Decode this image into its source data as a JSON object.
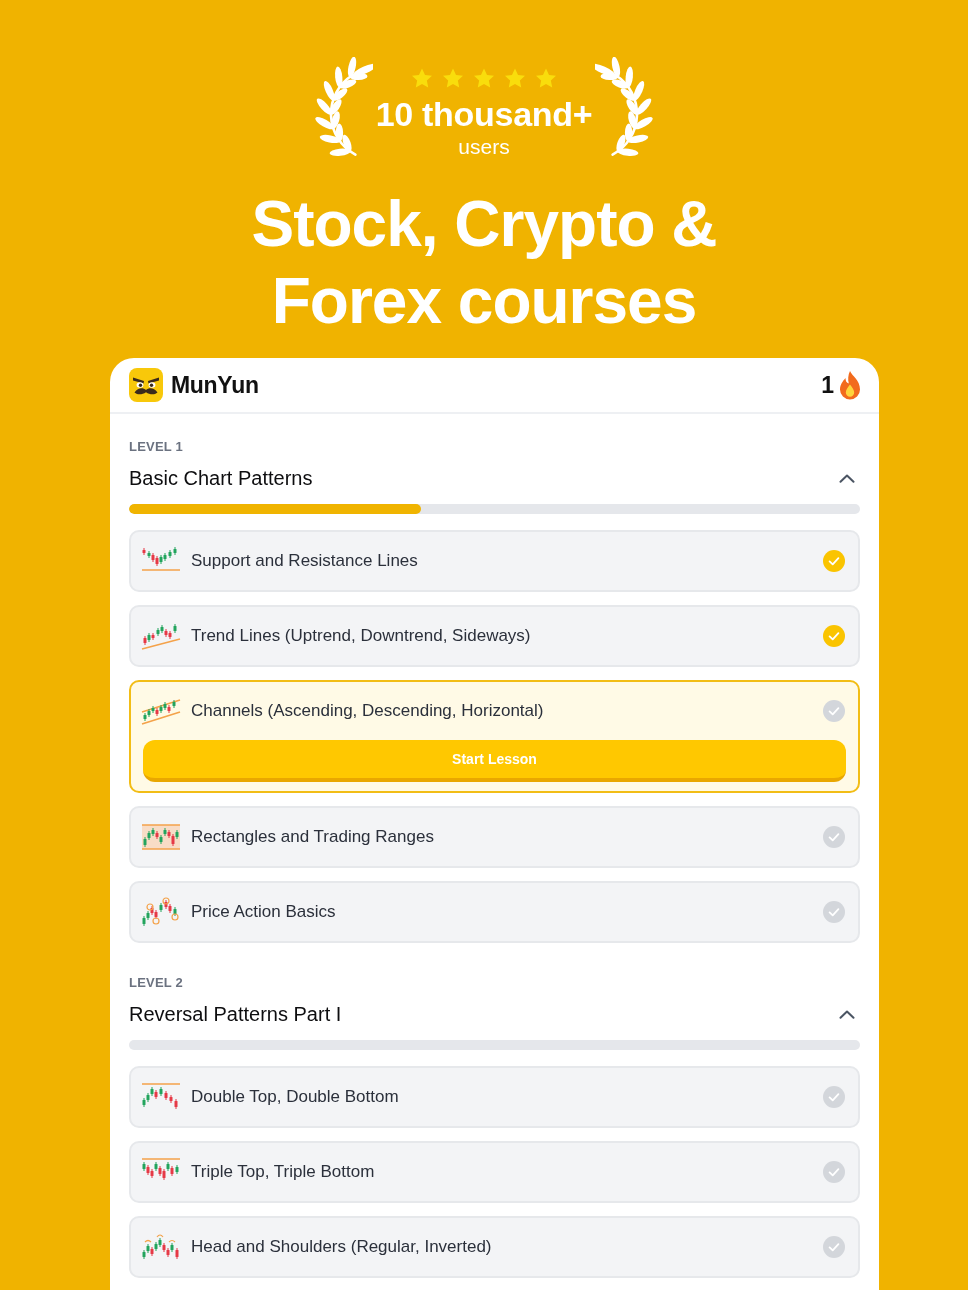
{
  "hero": {
    "stars": 5,
    "count": "10 thousand+",
    "caption": "users",
    "headline": "Stock, Crypto & Forex courses"
  },
  "app": {
    "brand": "MunYun",
    "streak": "1",
    "levels": [
      {
        "label": "LEVEL 1",
        "title": "Basic Chart Patterns",
        "expanded": true,
        "level": 0.4,
        "lessons": [
          {
            "title": "Support and Resistance Lines",
            "completed": true,
            "selected": false
          },
          {
            "title": "Trend Lines (Uptrend, Downtrend, Sideways)",
            "completed": true,
            "selected": false
          },
          {
            "title": "Channels (Ascending, Descending, Horizontal)",
            "completed": false,
            "selected": true,
            "button": "Start Lesson"
          },
          {
            "title": "Rectangles and Trading Ranges",
            "completed": false,
            "selected": false
          },
          {
            "title": "Price Action Basics",
            "completed": false,
            "selected": false
          }
        ]
      },
      {
        "label": "LEVEL 2",
        "title": "Reversal Patterns Part I",
        "expanded": true,
        "lessons": [
          {
            "title": "Double Top, Double Bottom",
            "completed": false,
            "selected": false
          },
          {
            "title": "Triple Top, Triple Bottom",
            "completed": false,
            "selected": false
          },
          {
            "title": "Head and Shoulders (Regular, Inverted)",
            "completed": false,
            "selected": false
          }
        ]
      }
    ]
  }
}
